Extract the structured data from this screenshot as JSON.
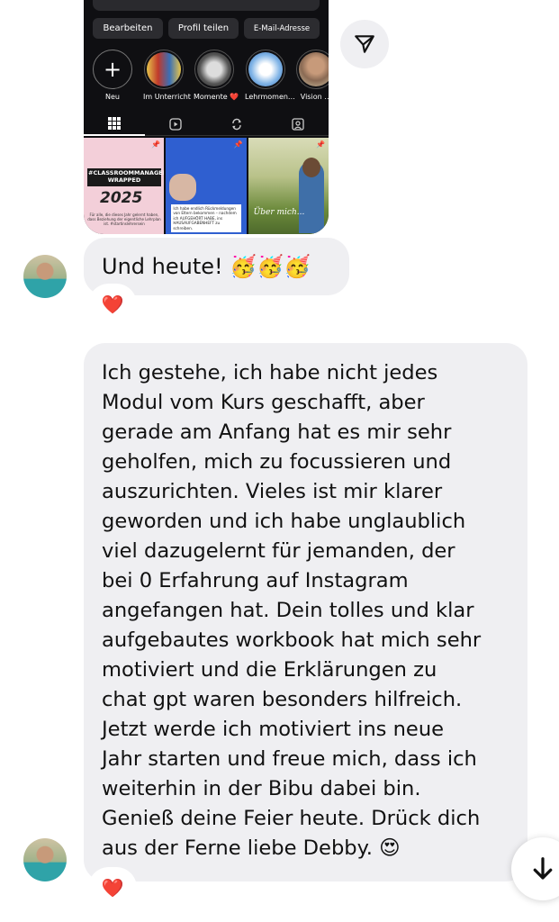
{
  "shared_profile": {
    "buttons": [
      "Bearbeiten",
      "Profil teilen",
      "E-Mail-Adresse"
    ],
    "stories": [
      {
        "label": "Neu"
      },
      {
        "label": "Im Unterricht"
      },
      {
        "label": "Momente ❤️"
      },
      {
        "label": "Lehrmomen…"
      },
      {
        "label": "Vision …"
      }
    ],
    "tabs": [
      "grid-icon",
      "reels-icon",
      "repost-icon",
      "tagged-icon"
    ],
    "posts": {
      "p1_headline": "#CLASSROOMMANAGEMENT WRAPPED",
      "p1_year": "2025",
      "p1_small": "Für alle, die dieses Jahr gelernt haben, dass Beziehung der eigentliche Lehrplan ist. #startinslehrersein",
      "p2_card": "Ich habe endlich Rückmeldungen von Eltern bekommen – nachdem ich AUFGEHÖRT HABE, ins HAUSAUFGABENHEFT zu schreiben.",
      "p3_caption": "Über mich..."
    }
  },
  "messages": [
    {
      "text": "Und heute! 🥳🥳🥳",
      "reaction": "❤️"
    },
    {
      "lines": [
        "Ich gestehe, ich habe nicht jedes",
        "Modul vom Kurs geschafft, aber",
        "gerade am Anfang hat es mir sehr",
        "geholfen, mich zu focussieren und",
        "auszurichten. Vieles ist mir klarer",
        "geworden und ich habe unglaublich",
        "viel dazugelernt für jemanden, der",
        "bei 0 Erfahrung auf Instagram",
        "angefangen hat. Dein tolles und klar",
        "aufgebautes workbook hat mich sehr",
        "motiviert und die Erklärungen zu",
        "chat gpt waren besonders hilfreich.",
        "Jetzt werde ich motiviert ins neue",
        "Jahr starten und freue mich, dass ich",
        "weiterhin in der Bibu dabei bin.",
        "Genieß deine Feier heute. Drück dich",
        "aus der Ferne liebe Debby. 😍"
      ],
      "reaction": "❤️"
    }
  ],
  "icons": {
    "share": "send-icon",
    "scroll": "arrow-down-icon",
    "new_story": "+"
  },
  "colors": {
    "bubble": "#efeff2",
    "heart": "#e0245e",
    "shot_bg": "#0f0f12"
  }
}
